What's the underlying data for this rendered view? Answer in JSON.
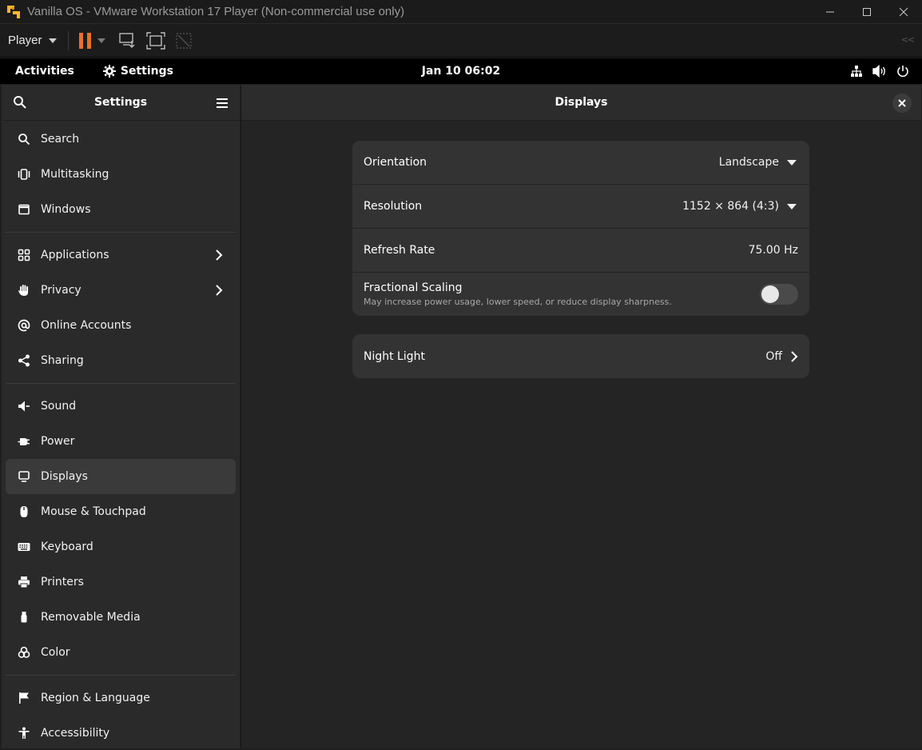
{
  "vm_window": {
    "title": "Vanilla OS - VMware Workstation 17 Player (Non-commercial use only)",
    "player_menu_label": "Player",
    "controls": [
      "minimize-icon",
      "maximize-icon",
      "close-icon"
    ]
  },
  "gnome_topbar": {
    "activities": "Activities",
    "app_name": "Settings",
    "clock": "Jan 10  06:02",
    "status_icons": [
      "network-icon",
      "volume-icon",
      "power-icon"
    ]
  },
  "sidebar": {
    "title": "Settings",
    "groups": [
      [
        {
          "label": "Search",
          "icon": "search-icon"
        },
        {
          "label": "Multitasking",
          "icon": "multitasking-icon"
        },
        {
          "label": "Windows",
          "icon": "windows-icon"
        }
      ],
      [
        {
          "label": "Applications",
          "icon": "applications-icon",
          "chevron": true
        },
        {
          "label": "Privacy",
          "icon": "privacy-hand-icon",
          "chevron": true
        },
        {
          "label": "Online Accounts",
          "icon": "at-sign-icon"
        },
        {
          "label": "Sharing",
          "icon": "share-icon"
        }
      ],
      [
        {
          "label": "Sound",
          "icon": "speaker-icon"
        },
        {
          "label": "Power",
          "icon": "power-plug-icon"
        },
        {
          "label": "Displays",
          "icon": "display-icon",
          "active": true
        },
        {
          "label": "Mouse & Touchpad",
          "icon": "mouse-icon"
        },
        {
          "label": "Keyboard",
          "icon": "keyboard-icon"
        },
        {
          "label": "Printers",
          "icon": "printer-icon"
        },
        {
          "label": "Removable Media",
          "icon": "usb-icon"
        },
        {
          "label": "Color",
          "icon": "color-icon"
        }
      ],
      [
        {
          "label": "Region & Language",
          "icon": "flag-icon"
        },
        {
          "label": "Accessibility",
          "icon": "accessibility-icon"
        }
      ]
    ]
  },
  "main": {
    "title": "Displays",
    "display_settings": {
      "orientation": {
        "label": "Orientation",
        "value": "Landscape"
      },
      "resolution": {
        "label": "Resolution",
        "value": "1152 × 864 (4:3)"
      },
      "refresh_rate": {
        "label": "Refresh Rate",
        "value": "75.00 Hz"
      },
      "fractional_scaling": {
        "label": "Fractional Scaling",
        "description": "May increase power usage, lower speed, or reduce display sharpness.",
        "enabled": false
      }
    },
    "night_light": {
      "label": "Night Light",
      "value": "Off"
    }
  },
  "colors": {
    "accent_pause": "#e8712b",
    "sidebar_bg": "#2a2a2a",
    "content_bg": "#242424",
    "card_bg": "#333333"
  }
}
